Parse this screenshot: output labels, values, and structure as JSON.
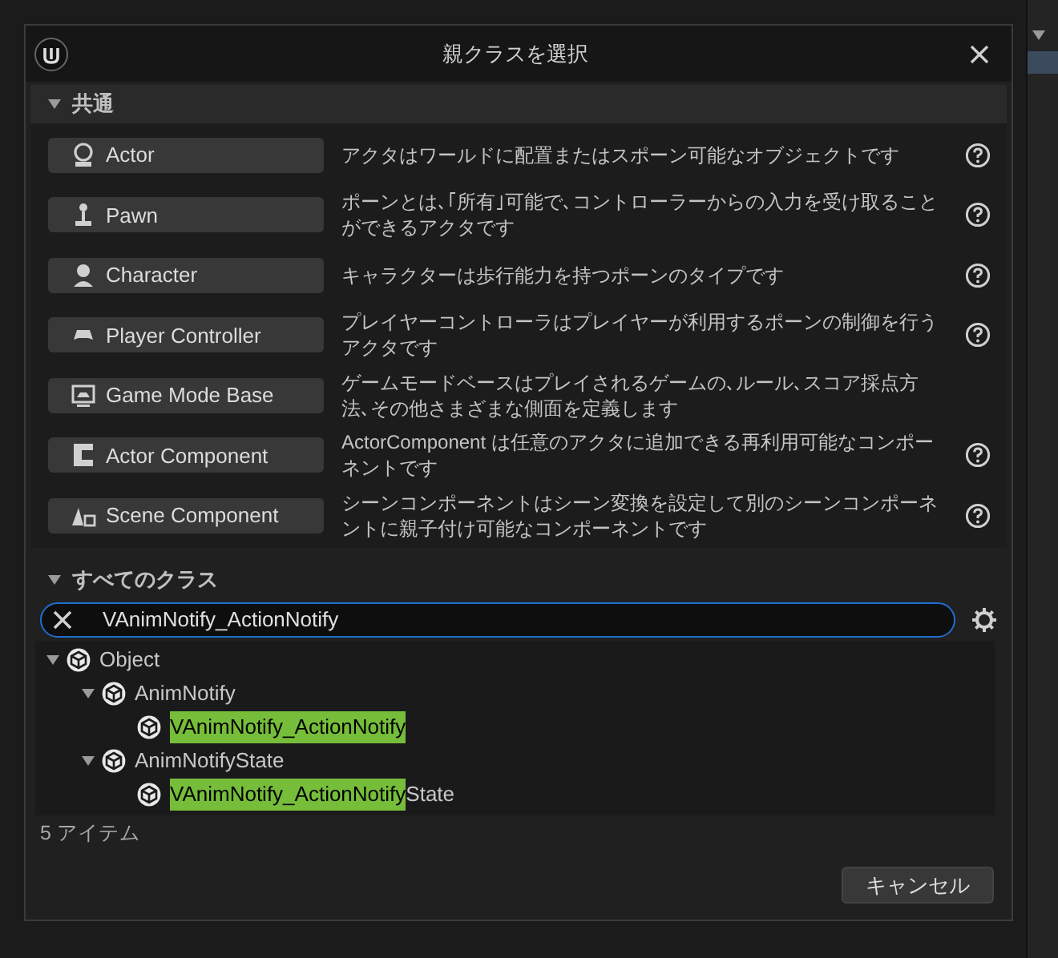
{
  "dialog": {
    "title": "親クラスを選択"
  },
  "common_section": {
    "title": "共通",
    "expanded": true,
    "classes": [
      {
        "label": "Actor",
        "description": "アクタはワールドに配置またはスポーン可能なオブジェクトです",
        "help": true
      },
      {
        "label": "Pawn",
        "description": "ポーンとは､｢所有｣可能で､コントローラーからの入力を受け取ることができるアクタです",
        "help": true
      },
      {
        "label": "Character",
        "description": "キャラクターは歩行能力を持つポーンのタイプです",
        "help": true
      },
      {
        "label": "Player Controller",
        "description": "プレイヤーコントローラはプレイヤーが利用するポーンの制御を行うアクタです",
        "help": true
      },
      {
        "label": "Game Mode Base",
        "description": "ゲームモードベースはプレイされるゲームの､ルール､スコア採点方法､その他さまざまな側面を定義します",
        "help": false
      },
      {
        "label": "Actor Component",
        "description": "ActorComponent は任意のアクタに追加できる再利用可能なコンポーネントです",
        "help": true
      },
      {
        "label": "Scene Component",
        "description": "シーンコンポーネントはシーン変換を設定して別のシーンコンポーネントに親子付け可能なコンポーネントです",
        "help": true
      }
    ]
  },
  "all_section": {
    "title": "すべてのクラス",
    "expanded": true,
    "search": {
      "value": "VAnimNotify_ActionNotify"
    },
    "tree": [
      {
        "rest": "Object",
        "expanded": true,
        "children": [
          {
            "rest": "AnimNotify",
            "expanded": true,
            "children": [
              {
                "match": "VAnimNotify_ActionNotify"
              }
            ]
          },
          {
            "rest": "AnimNotifyState",
            "expanded": true,
            "children": [
              {
                "match": "VAnimNotify_ActionNotify",
                "rest": "State"
              }
            ]
          }
        ]
      }
    ],
    "status": "5 アイテム"
  },
  "buttons": [
    {
      "label": "キャンセル"
    }
  ]
}
